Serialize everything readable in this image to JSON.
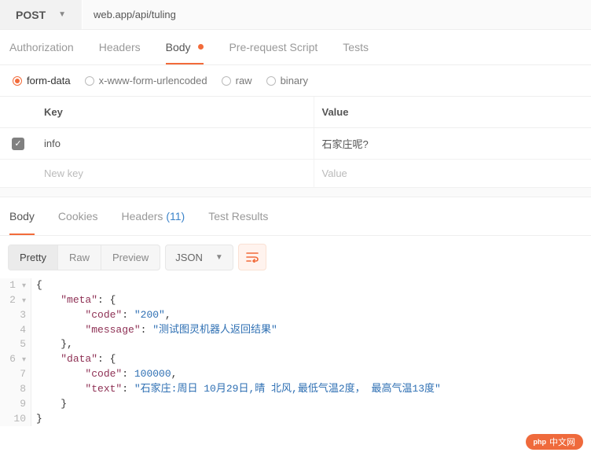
{
  "request": {
    "method": "POST",
    "url": "web.app/api/tuling"
  },
  "reqTabs": {
    "authorization": "Authorization",
    "headers": "Headers",
    "body": "Body",
    "prerequest": "Pre-request Script",
    "tests": "Tests"
  },
  "bodyTypes": {
    "formData": "form-data",
    "urlencoded": "x-www-form-urlencoded",
    "raw": "raw",
    "binary": "binary"
  },
  "kvHeaders": {
    "key": "Key",
    "value": "Value"
  },
  "formData": [
    {
      "checked": true,
      "key": "info",
      "value": "石家庄呢?"
    }
  ],
  "kvPlaceholders": {
    "key": "New key",
    "value": "Value"
  },
  "respTabs": {
    "body": "Body",
    "cookies": "Cookies",
    "headers": "Headers",
    "headersCount": "(11)",
    "testResults": "Test Results"
  },
  "viewModes": {
    "pretty": "Pretty",
    "raw": "Raw",
    "preview": "Preview"
  },
  "format": "JSON",
  "response": {
    "lines": [
      {
        "n": "1",
        "fold": true,
        "html": "<span class='p'>{</span>"
      },
      {
        "n": "2",
        "fold": true,
        "html": "    <span class='k'>\"meta\"</span><span class='p'>: {</span>"
      },
      {
        "n": "3",
        "fold": false,
        "html": "        <span class='k'>\"code\"</span><span class='p'>: </span><span class='s'>\"200\"</span><span class='p'>,</span>"
      },
      {
        "n": "4",
        "fold": false,
        "html": "        <span class='k'>\"message\"</span><span class='p'>: </span><span class='s'>\"测试图灵机器人返回结果\"</span>"
      },
      {
        "n": "5",
        "fold": false,
        "html": "    <span class='p'>},</span>"
      },
      {
        "n": "6",
        "fold": true,
        "html": "    <span class='k'>\"data\"</span><span class='p'>: {</span>"
      },
      {
        "n": "7",
        "fold": false,
        "html": "        <span class='k'>\"code\"</span><span class='p'>: </span><span class='n'>100000</span><span class='p'>,</span>"
      },
      {
        "n": "8",
        "fold": false,
        "html": "        <span class='k'>\"text\"</span><span class='p'>: </span><span class='s'>\"石家庄:周日 10月29日,晴 北风,最低气温2度， 最高气温13度\"</span>"
      },
      {
        "n": "9",
        "fold": false,
        "html": "    <span class='p'>}</span>"
      },
      {
        "n": "10",
        "fold": false,
        "html": "<span class='p'>}</span>"
      }
    ]
  },
  "watermark": "中文网"
}
